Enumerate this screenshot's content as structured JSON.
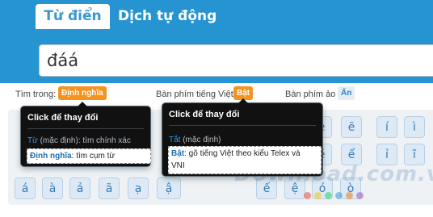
{
  "tabs": [
    {
      "label": "Từ điển",
      "active": true
    },
    {
      "label": "Dịch tự động",
      "active": false
    }
  ],
  "search": {
    "value": "đáá"
  },
  "options": {
    "search_in_label": "Tìm trong:",
    "search_in_value": "Định nghĩa",
    "vn_keyboard_label": "Bàn phím tiếng Việt",
    "vn_keyboard_value": "Bật",
    "virtual_keyboard_label": "Bàn phím ảo",
    "virtual_keyboard_value": "Ẩn"
  },
  "tooltip_search": {
    "title": "Click để thay đổi",
    "line1_key": "Từ",
    "line1_rest": " (mặc định): tìm chính xác",
    "line2_key": "Định nghĩa",
    "line2_rest": ": tìm cụm từ"
  },
  "tooltip_keyboard": {
    "title": "Click để thay đổi",
    "line1_key": "Tắt",
    "line1_rest": " (mặc định)",
    "line2_key": "Bật",
    "line2_rest": ": gõ tiếng Việt theo kiểu Telex và",
    "line2_cont": "VNI"
  },
  "keyboard": {
    "row1_right": [
      "ê",
      "ẽ",
      "í",
      "ì"
    ],
    "row2_right": [
      "ề",
      "ể",
      "ỉ",
      "ĩ"
    ],
    "row3_left": [
      "á",
      "à",
      "ả",
      "ã",
      "ạ",
      "ậ"
    ],
    "row3_right": [
      "ế",
      "ệ",
      "ó",
      "ò"
    ]
  },
  "watermark": "Download.com.vn",
  "colors": {
    "header": "#2794d2",
    "accent_orange": "#f5931e",
    "key_bg": "#ddeaf5",
    "tooltip_bg": "#111111",
    "dots": [
      "#e74c3c",
      "#f1c40f",
      "#2ecc71",
      "#3498db",
      "#e67e22",
      "#9b59b6"
    ]
  }
}
